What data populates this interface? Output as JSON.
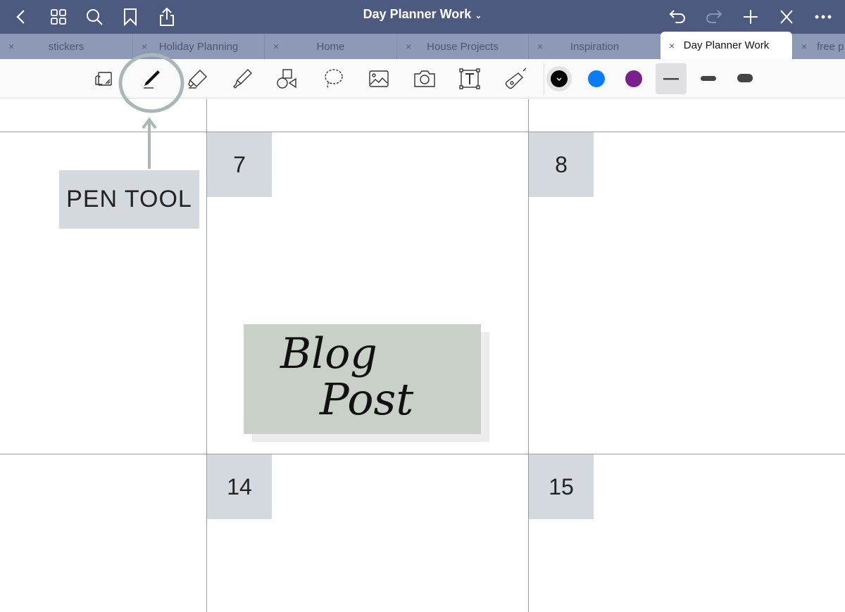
{
  "header": {
    "title": "Day Planner Work",
    "icons": [
      "back-icon",
      "grid-icon",
      "search-icon",
      "bookmark-icon",
      "share-icon",
      "undo-icon",
      "redo-icon",
      "add-icon",
      "close-edit-icon",
      "more-icon"
    ]
  },
  "tabs": [
    {
      "label": "stickers",
      "active": false
    },
    {
      "label": "Holiday Planning",
      "active": false
    },
    {
      "label": "Home",
      "active": false
    },
    {
      "label": "House Projects",
      "active": false
    },
    {
      "label": "Inspiration",
      "active": false
    },
    {
      "label": "Day Planner Work",
      "active": true
    },
    {
      "label": "free p",
      "active": false
    }
  ],
  "tab_close": "×",
  "toolbar": {
    "tools": [
      "read-mode",
      "pen",
      "eraser",
      "highlighter",
      "shapes",
      "lasso",
      "image",
      "camera",
      "text",
      "laser-pointer"
    ],
    "selected": "pen",
    "colors": [
      "#000000",
      "#0a7cff",
      "#7b1f8f"
    ],
    "selected_color": "#000000",
    "stroke_widths": [
      "thin",
      "medium",
      "thick"
    ],
    "selected_width": "thin"
  },
  "calendar": {
    "days": [
      "7",
      "8",
      "14",
      "15"
    ]
  },
  "annotation": {
    "label": "PEN TOOL",
    "circle_color": "#a9b7b8"
  },
  "sticky": {
    "text_line1": "Blog",
    "text_line2": "Post",
    "color": "#c9d0c8"
  }
}
